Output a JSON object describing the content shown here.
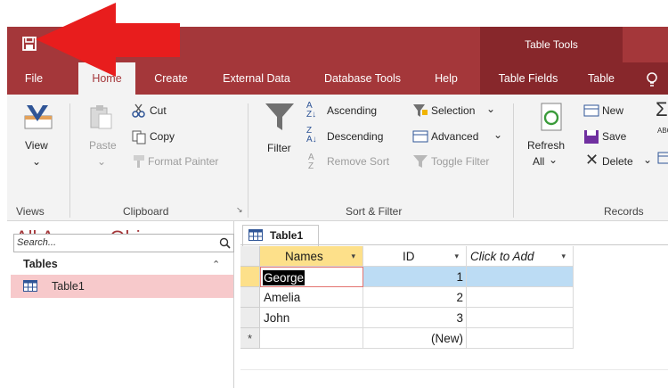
{
  "window": {
    "contextual_group": "Table Tools"
  },
  "tabs": [
    {
      "label": "File"
    },
    {
      "label": "Home"
    },
    {
      "label": "Create"
    },
    {
      "label": "External Data"
    },
    {
      "label": "Database Tools"
    },
    {
      "label": "Help"
    },
    {
      "label": "Table Fields"
    },
    {
      "label": "Table"
    }
  ],
  "ribbon": {
    "views": {
      "view": "View",
      "group": "Views"
    },
    "clipboard": {
      "paste": "Paste",
      "cut": "Cut",
      "copy": "Copy",
      "format_painter": "Format Painter",
      "group": "Clipboard"
    },
    "sort_filter": {
      "filter": "Filter",
      "ascending": "Ascending",
      "descending": "Descending",
      "remove_sort": "Remove Sort",
      "selection": "Selection",
      "advanced": "Advanced",
      "toggle_filter": "Toggle Filter",
      "group": "Sort & Filter"
    },
    "records": {
      "refresh": "Refresh",
      "refresh_all": "All",
      "new": "New",
      "save": "Save",
      "delete": "Delete",
      "group": "Records"
    }
  },
  "nav": {
    "title": "All Access Obje...",
    "search_placeholder": "Search...",
    "section": "Tables",
    "items": [
      {
        "label": "Table1"
      }
    ]
  },
  "document": {
    "tab_label": "Table1",
    "columns": [
      {
        "label": "Names"
      },
      {
        "label": "ID"
      },
      {
        "label": "Click to Add"
      }
    ],
    "rows": [
      {
        "names": "George",
        "id": "1"
      },
      {
        "names": "Amelia",
        "id": "2"
      },
      {
        "names": "John",
        "id": "3"
      }
    ],
    "new_row_id": "(New)",
    "new_row_marker": "*"
  },
  "colors": {
    "access_red": "#a4373a",
    "contextual_red": "#87272b",
    "selected_row": "#bcdcf4",
    "header_highlight": "#fde08a"
  }
}
